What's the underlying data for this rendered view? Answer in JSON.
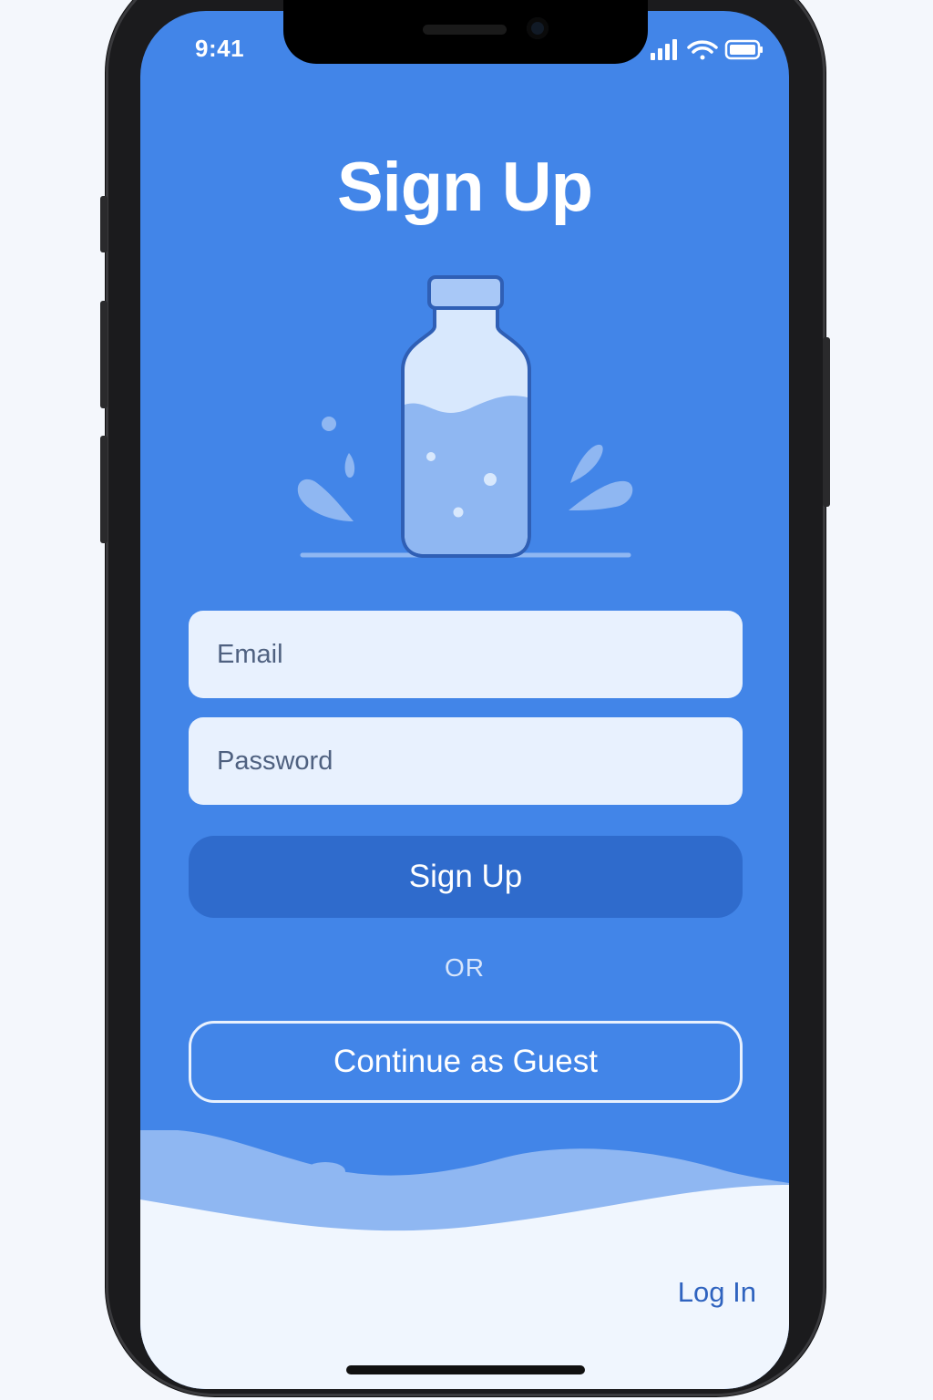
{
  "status_bar": {
    "time": "9:41",
    "icons": [
      "cellular-signal-icon",
      "wifi-icon",
      "battery-icon"
    ]
  },
  "page": {
    "title": "Sign Up",
    "illustration": "water-bottle-illustration"
  },
  "form": {
    "email_placeholder": "Email",
    "email_value": "",
    "password_placeholder": "Password",
    "password_value": "",
    "signup_label": "Sign Up",
    "or_label": "OR",
    "guest_label": "Continue as Guest"
  },
  "footer": {
    "login_label": "Log In"
  },
  "colors": {
    "background": "#4285e8",
    "field_background": "#e8f1fe",
    "primary_button": "#2f6bcc",
    "wave_light": "#8fb7f2",
    "footer_background": "#f0f6fe",
    "link": "#2f63bf"
  }
}
